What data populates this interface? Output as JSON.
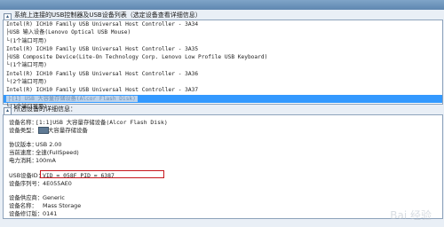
{
  "window": {
    "title": "系统上连接的USB控制器及USB设备列表（选定设备查看详细信息）"
  },
  "device_list": {
    "header": "系统上连接的USB控制器及USB设备列表（选定设备查看详细信息）",
    "rows": [
      "Intel(R) ICH10 Family USB Universal Host Controller - 3A34",
      "├USB 输入设备(Lenovo Optical USB Mouse)",
      "└(1个端口可用)",
      "Intel(R) ICH10 Family USB Universal Host Controller - 3A35",
      "├USB Composite Device(Lite-On Technology Corp. Lenovo Low Profile USB Keyboard)",
      "└(1个端口可用)",
      "Intel(R) ICH10 Family USB Universal Host Controller - 3A36",
      "└(2个端口可用)",
      "Intel(R) ICH10 Family USB Universal Host Controller - 3A37",
      "├[1] USB 大容量存储设备(Alcor Flash Disk)",
      "└(1个端口可用)"
    ],
    "selected_index": 9,
    "selected_label": "USB 大容量存储设备(Alcor Flash Disk)"
  },
  "details": {
    "header": "所选设备的详细信息：",
    "device_name_key": "设备名称：",
    "device_name": "[1:1]USB 大容量存储设备(Alcor Flash Disk)",
    "device_type_key": "设备类型：",
    "device_type": "大容量存储设备",
    "protocol_key": "协议版本：",
    "protocol": "USB 2.00",
    "speed_key": "当前速度：",
    "speed": "全速(FullSpeed)",
    "power_key": "电力消耗：",
    "power": "100mA",
    "usb_id_key": "USB设备ID：",
    "usb_id": "VID = 058F PID = 6387",
    "serial_key": "设备序列号：",
    "serial": "4E055AE0",
    "vendor_key": "设备供应商：",
    "vendor": "Generic",
    "product_key": "设备名称：",
    "product": "Mass Storage",
    "revision_key": "设备修订版：",
    "revision": "0141"
  },
  "watermark": "Bai 经验",
  "colors": {
    "selection": "#3399ff",
    "highlight_box": "#c6161c"
  }
}
